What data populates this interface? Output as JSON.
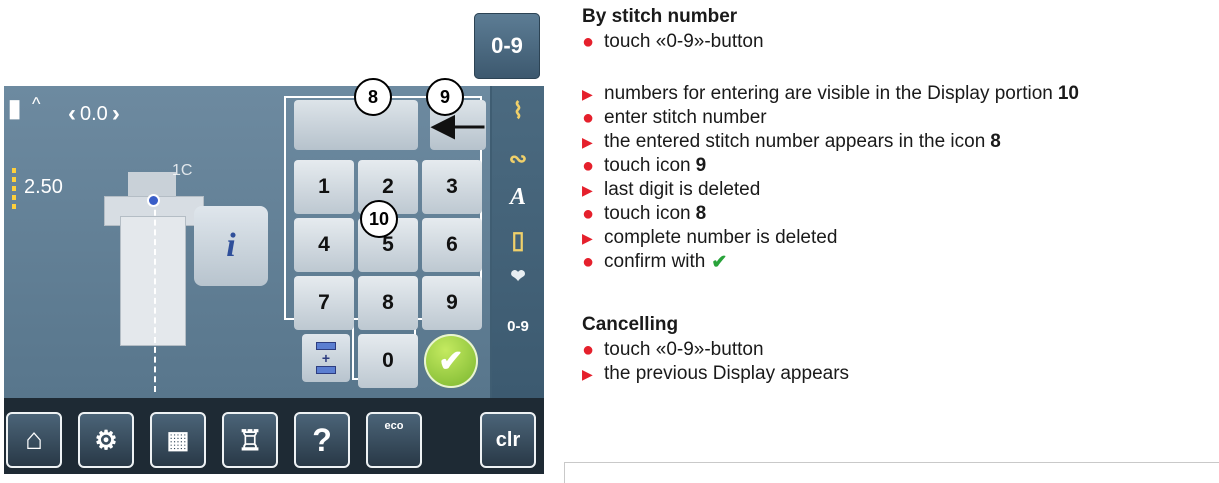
{
  "zero_nine_button": "0-9",
  "screen": {
    "width_value": "0.0",
    "length_value": "2.50",
    "presser_label": "1C",
    "number_field": "",
    "keys": [
      "1",
      "2",
      "3",
      "4",
      "5",
      "6",
      "7",
      "8",
      "9",
      "0"
    ],
    "right_panel_label": "0-9",
    "toolbar": {
      "home_icon": "home-icon",
      "setup_icon": "setup-icon",
      "tutorial_icon": "book-icon",
      "sewing_advisor_icon": "dress-form-icon",
      "help_label": "?",
      "eco_label": "eco",
      "clr_label": "clr"
    }
  },
  "callouts": {
    "field": "8",
    "backspace": "9",
    "keypad": "10"
  },
  "instructions": {
    "section1_title": "By stitch number",
    "s1_line1": "touch «0-9»-button",
    "step1_text": "numbers for entering are visible in the Display portion ",
    "step1_bold": "10",
    "step2": "enter stitch number",
    "step3_text": "the entered stitch number appears in the icon ",
    "step3_bold": "8",
    "step4_text": "touch icon ",
    "step4_bold": "9",
    "step5": "last digit is deleted",
    "step6_text": "touch icon ",
    "step6_bold": "8",
    "step7": "complete number is deleted",
    "step8": "confirm with",
    "section2_title": "Cancelling",
    "c_line1": "touch «0-9»-button",
    "c_line2": "the previous Display appears"
  },
  "colors": {
    "bullet": "#e5202c",
    "check": "#29a33a",
    "screen_bg": "#58768c"
  }
}
